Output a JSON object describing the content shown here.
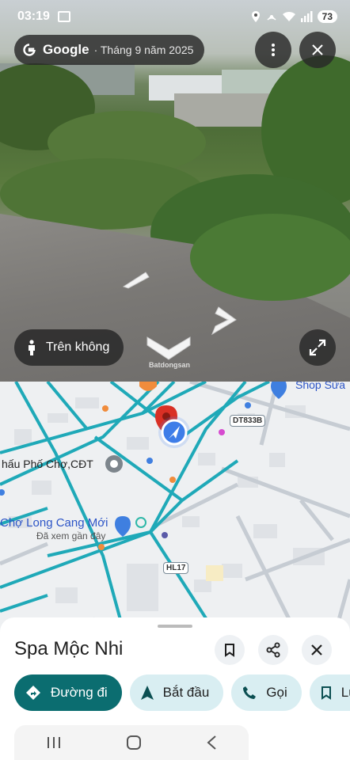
{
  "status_bar": {
    "time": "03:19",
    "battery": "73"
  },
  "streetview": {
    "brand": "Google",
    "date": "· Tháng 9 năm 2025",
    "mode_label": "Trên không",
    "watermark": "Batdongsan"
  },
  "map": {
    "labels": {
      "shop": "Shop Sữa",
      "pho_cho": "hấu Phố Chợ,CĐT",
      "market": "Chợ Long Cang Mới",
      "recent": "Đã xem gần đây"
    },
    "road_tags": [
      "DT833B",
      "HL17"
    ]
  },
  "place": {
    "title": "Spa Mộc Nhi",
    "actions": {
      "directions": "Đường đi",
      "start": "Bắt đầu",
      "call": "Gọi",
      "save": "Lưu"
    }
  },
  "colors": {
    "primary": "#0b6d70",
    "chip_bg": "#d9eef2",
    "road": "#1fa9b8"
  },
  "icons": [
    "google-logo-icon",
    "more-vert-icon",
    "close-icon",
    "person-icon",
    "expand-icon",
    "bookmark-icon",
    "share-icon",
    "directions-icon",
    "navigation-icon",
    "phone-icon",
    "nav-recents-icon",
    "nav-home-icon",
    "nav-back-icon"
  ]
}
